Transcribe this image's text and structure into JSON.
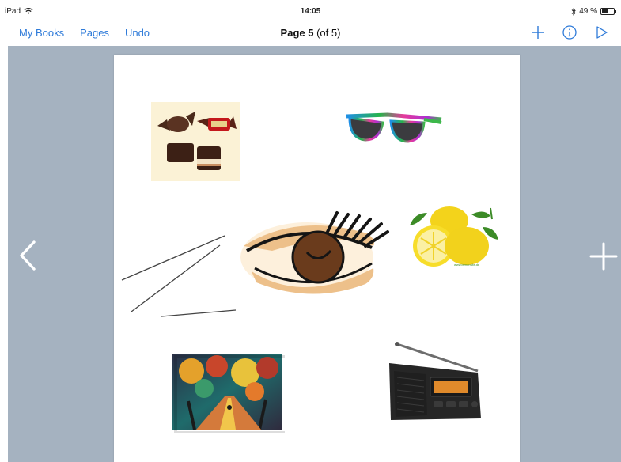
{
  "status_bar": {
    "device": "iPad",
    "time": "14:05",
    "battery": "49 %",
    "battery_level": 0.49
  },
  "nav": {
    "my_books": "My Books",
    "pages": "Pages",
    "undo": "Undo",
    "title_bold": "Page 5",
    "title_rest": " (of 5)",
    "accent_color": "#2f7bd9",
    "actions": [
      "plus-icon",
      "info-icon",
      "play-icon"
    ]
  },
  "canvas": {
    "background": "#a5b2c0",
    "nav_icons": [
      "chevron-left-icon",
      "plus-icon"
    ]
  },
  "page_items": [
    "candies-image",
    "sunglasses-image",
    "needles-image",
    "eye-image",
    "lemons-image",
    "painting-image",
    "radio-image"
  ],
  "lemon_watermark": "www.lemonsite.de"
}
